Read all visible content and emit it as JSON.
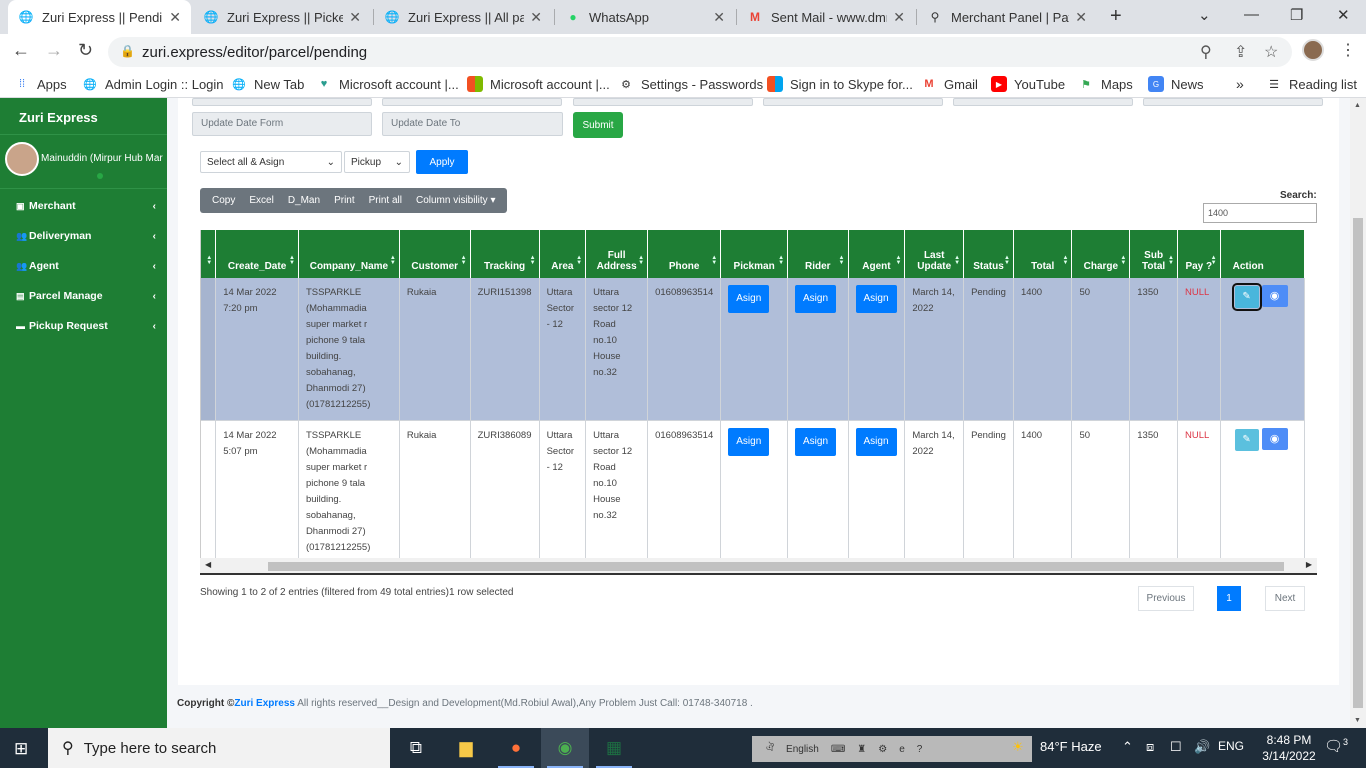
{
  "browser": {
    "tabs": [
      {
        "title": "Zuri Express || Pending",
        "icon": "globe-icon"
      },
      {
        "title": "Zuri Express || Picked",
        "icon": "globe-icon"
      },
      {
        "title": "Zuri Express || All parc",
        "icon": "globe-icon"
      },
      {
        "title": "WhatsApp",
        "icon": "whatsapp-icon"
      },
      {
        "title": "Sent Mail - www.dmm",
        "icon": "gmail-icon"
      },
      {
        "title": "Merchant Panel | Path",
        "icon": "bike-icon"
      }
    ],
    "url": "zuri.express/editor/parcel/pending",
    "bookmarks": [
      {
        "label": "Apps",
        "icon": "apps-grid-icon"
      },
      {
        "label": "Admin Login :: Login",
        "icon": "globe-icon"
      },
      {
        "label": "New Tab",
        "icon": "globe-icon"
      },
      {
        "label": "Microsoft account |...",
        "icon": "heart-icon"
      },
      {
        "label": "Microsoft account |...",
        "icon": "windows-icon"
      },
      {
        "label": "Settings - Passwords",
        "icon": "gear-icon"
      },
      {
        "label": "Sign in to Skype for...",
        "icon": "windows-icon"
      },
      {
        "label": "Gmail",
        "icon": "gmail-icon"
      },
      {
        "label": "YouTube",
        "icon": "youtube-icon"
      },
      {
        "label": "Maps",
        "icon": "maps-pin-icon"
      },
      {
        "label": "News",
        "icon": "news-icon"
      }
    ],
    "overflow": "»",
    "reading_list": "Reading list"
  },
  "sidebar": {
    "brand": "Zuri Express",
    "user": "Mainuddin (Mirpur Hub Mar",
    "items": [
      {
        "label": "Merchant",
        "icon": "briefcase-icon"
      },
      {
        "label": "Deliveryman",
        "icon": "users-icon"
      },
      {
        "label": "Agent",
        "icon": "users-icon"
      },
      {
        "label": "Parcel Manage",
        "icon": "gift-icon"
      },
      {
        "label": "Pickup Request",
        "icon": "truck-icon"
      }
    ]
  },
  "filters": {
    "update_from_placeholder": "Update Date Form",
    "update_to_placeholder": "Update Date To",
    "submit_label": "Submit",
    "bulk_select": "Select all & Asign",
    "status_select": "Pickup",
    "apply_label": "Apply"
  },
  "toolbar_buttons": [
    "Copy",
    "Excel",
    "D_Man",
    "Print",
    "Print all",
    "Column visibility ▾"
  ],
  "search": {
    "label": "Search:",
    "value": "1400"
  },
  "table": {
    "columns": [
      "I",
      "Create_Date",
      "Company_Name",
      "Customer",
      "Tracking",
      "Area",
      "Full Address",
      "Phone",
      "Pickman",
      "Rider",
      "Agent",
      "Last Update",
      "Status",
      "Total",
      "Charge",
      "Sub Total",
      "Pay ?",
      "Action"
    ],
    "assign_label": "Asign",
    "rows": [
      {
        "create_date": "14 Mar 2022 7:20 pm",
        "company": "TSSPARKLE (Mohammadia super market r pichone 9 tala building. sobahanag, Dhanmodi 27) (01781212255)",
        "customer": "Rukaia",
        "tracking": "ZURI151398",
        "area": "Uttara Sector - 12",
        "address": "Uttara sector 12 Road no.10 House no.32",
        "phone": "01608963514",
        "last_update": "March 14, 2022",
        "status": "Pending",
        "total": "1400",
        "charge": "50",
        "sub_total": "1350",
        "pay": "NULL"
      },
      {
        "create_date": "14 Mar 2022 5:07 pm",
        "company": "TSSPARKLE (Mohammadia super market r pichone 9 tala building. sobahanag, Dhanmodi 27) (01781212255)",
        "customer": "Rukaia",
        "tracking": "ZURI386089",
        "area": "Uttara Sector - 12",
        "address": "Uttara sector 12 Road no.10 House no.32",
        "phone": "01608963514",
        "last_update": "March 14, 2022",
        "status": "Pending",
        "total": "1400",
        "charge": "50",
        "sub_total": "1350",
        "pay": "NULL"
      }
    ]
  },
  "info": "Showing 1 to 2 of 2 entries (filtered from 49 total entries)1 row selected",
  "pagination": {
    "previous": "Previous",
    "current": "1",
    "next": "Next"
  },
  "footer": {
    "prefix": "Copyright ©",
    "brand": "Zuri Express",
    "text": " All rights reserved__Design and Development(Md.Robiul Awal),Any Problem Just Call: 01748-340718 ."
  },
  "taskbar": {
    "search_placeholder": "Type here to search",
    "language_bar": "English",
    "weather": "84°F  Haze",
    "lang": "ENG",
    "time": "8:48 PM",
    "date": "3/14/2022",
    "notifications": "3"
  }
}
